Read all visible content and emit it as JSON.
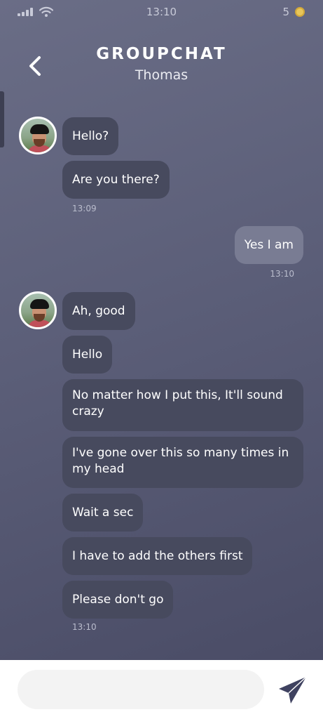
{
  "status": {
    "time": "13:10",
    "coins": "5"
  },
  "header": {
    "title": "GROUPCHAT",
    "subtitle": "Thomas"
  },
  "messages": [
    {
      "text": "Hello?",
      "from": "Thomas"
    },
    {
      "text": "Are you there?",
      "from": "Thomas"
    },
    {
      "text": "13:09"
    },
    {
      "text": "Yes I am",
      "from": "me"
    },
    {
      "text": "13:10"
    },
    {
      "text": "Ah, good",
      "from": "Thomas"
    },
    {
      "text": "Hello",
      "from": "Thomas"
    },
    {
      "text": "No matter how I put this, It'll sound crazy",
      "from": "Thomas"
    },
    {
      "text": "I've gone over this so many times in my head",
      "from": "Thomas"
    },
    {
      "text": "Wait a sec",
      "from": "Thomas"
    },
    {
      "text": "I have to add the others first",
      "from": "Thomas"
    },
    {
      "text": "Please don't go",
      "from": "Thomas"
    },
    {
      "text": "13:10"
    }
  ],
  "composer": {
    "placeholder": ""
  },
  "icons": {
    "back": "chevron-left-icon",
    "send": "paper-plane-icon",
    "signal": "cellular-signal-icon",
    "wifi": "wifi-icon",
    "coin": "coin-icon"
  },
  "colors": {
    "background_top": "#6a6d86",
    "background_bottom": "#4a4c66",
    "incoming_bubble": "#474a5e",
    "outgoing_bubble": "#797c93",
    "send_icon": "#3f4260",
    "coin": "#e8c65a"
  }
}
